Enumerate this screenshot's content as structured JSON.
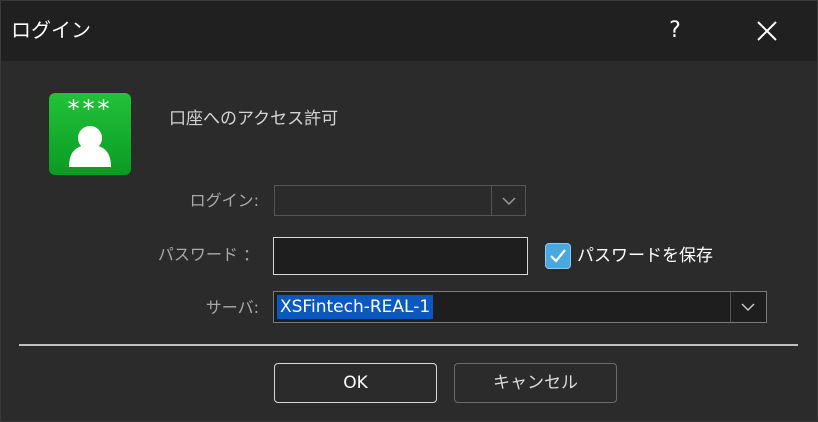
{
  "window": {
    "title": "ログイン",
    "help_label": "?"
  },
  "dialog": {
    "heading": "口座へのアクセス許可",
    "app_icon_stars": "***",
    "login": {
      "label": "ログイン:",
      "value": ""
    },
    "password": {
      "label": "パスワード ：",
      "value": ""
    },
    "save_password": {
      "label": "パスワードを保存",
      "checked": true
    },
    "server": {
      "label": "サーバ:",
      "value": "XSFintech-REAL-1"
    }
  },
  "buttons": {
    "ok": "OK",
    "cancel": "キャンセル"
  },
  "colors": {
    "accent_check": "#4aa8e0",
    "selection": "#0a58c2",
    "icon_green": "#16b02e"
  },
  "icons": {
    "close": "close-icon",
    "help": "help-icon",
    "dropdown": "chevron-down-icon",
    "check": "check-icon",
    "app": "user-key-icon"
  }
}
